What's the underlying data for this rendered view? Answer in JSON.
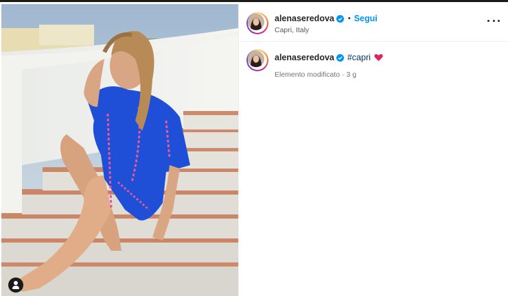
{
  "post": {
    "username": "alenaseredova",
    "separator": "•",
    "follow_label": "Segui",
    "location": "Capri, Italy"
  },
  "caption": {
    "username": "alenaseredova",
    "hashtag": "#capri",
    "emoji": "heart",
    "meta": "Elemento modificato · 3 g"
  },
  "icons": {
    "verified": "verified-badge-icon",
    "more": "more-options-icon",
    "user_tag": "user-tag-icon",
    "heart": "red-heart-emoji"
  },
  "colors": {
    "accent": "#0095f6",
    "hashtag": "#00376b",
    "heart": "#e0245e",
    "dress": "#1f4fd6"
  }
}
